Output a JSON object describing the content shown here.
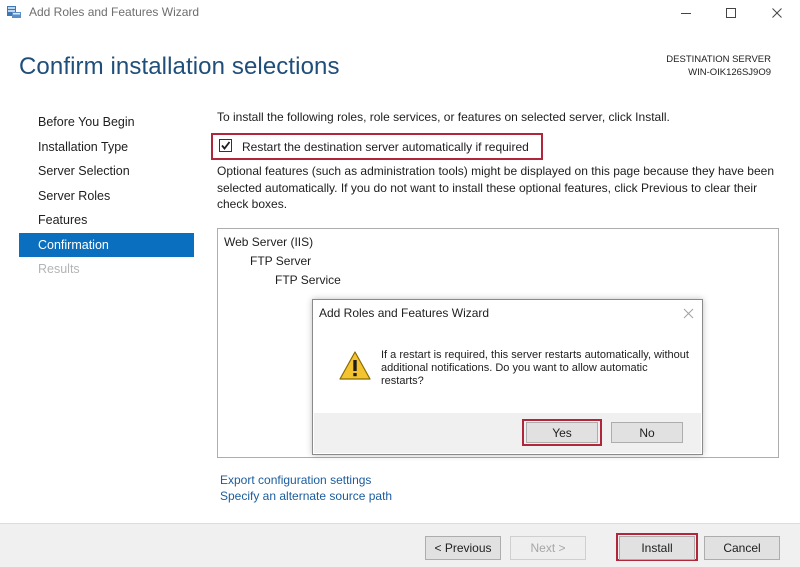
{
  "window": {
    "title": "Add Roles and Features Wizard",
    "controls": [
      "minimize-icon",
      "maximize-icon",
      "close-icon"
    ]
  },
  "header": {
    "title": "Confirm installation selections",
    "destination_label": "DESTINATION SERVER",
    "destination_value": "WIN-OIK126SJ9O9"
  },
  "nav": {
    "items": [
      {
        "label": "Before You Begin",
        "state": "normal"
      },
      {
        "label": "Installation Type",
        "state": "normal"
      },
      {
        "label": "Server Selection",
        "state": "normal"
      },
      {
        "label": "Server Roles",
        "state": "normal"
      },
      {
        "label": "Features",
        "state": "normal"
      },
      {
        "label": "Confirmation",
        "state": "active"
      },
      {
        "label": "Results",
        "state": "disabled"
      }
    ]
  },
  "content": {
    "intro": "To install the following roles, role services, or features on selected server, click Install.",
    "restart_label": "Restart the destination server automatically if required",
    "restart_checked": true,
    "optional_text": "Optional features (such as administration tools) might be displayed on this page because they have been selected automatically. If you do not want to install these optional features, click Previous to clear their check boxes.",
    "features": [
      "Web Server (IIS)",
      "FTP Server",
      "FTP Service"
    ],
    "export_link": "Export configuration settings",
    "alternate_link": "Specify an alternate source path"
  },
  "footer": {
    "previous": "< Previous",
    "next": "Next >",
    "install": "Install",
    "cancel": "Cancel"
  },
  "dialog": {
    "title": "Add Roles and Features Wizard",
    "message": "If a restart is required, this server restarts automatically, without additional notifications. Do you want to allow automatic restarts?",
    "yes": "Yes",
    "no": "No",
    "icon": "warning-icon"
  },
  "colors": {
    "accent": "#0b6fbf",
    "title_blue": "#1e4e79",
    "highlight": "#b0263b",
    "link": "#1a5c9e"
  }
}
